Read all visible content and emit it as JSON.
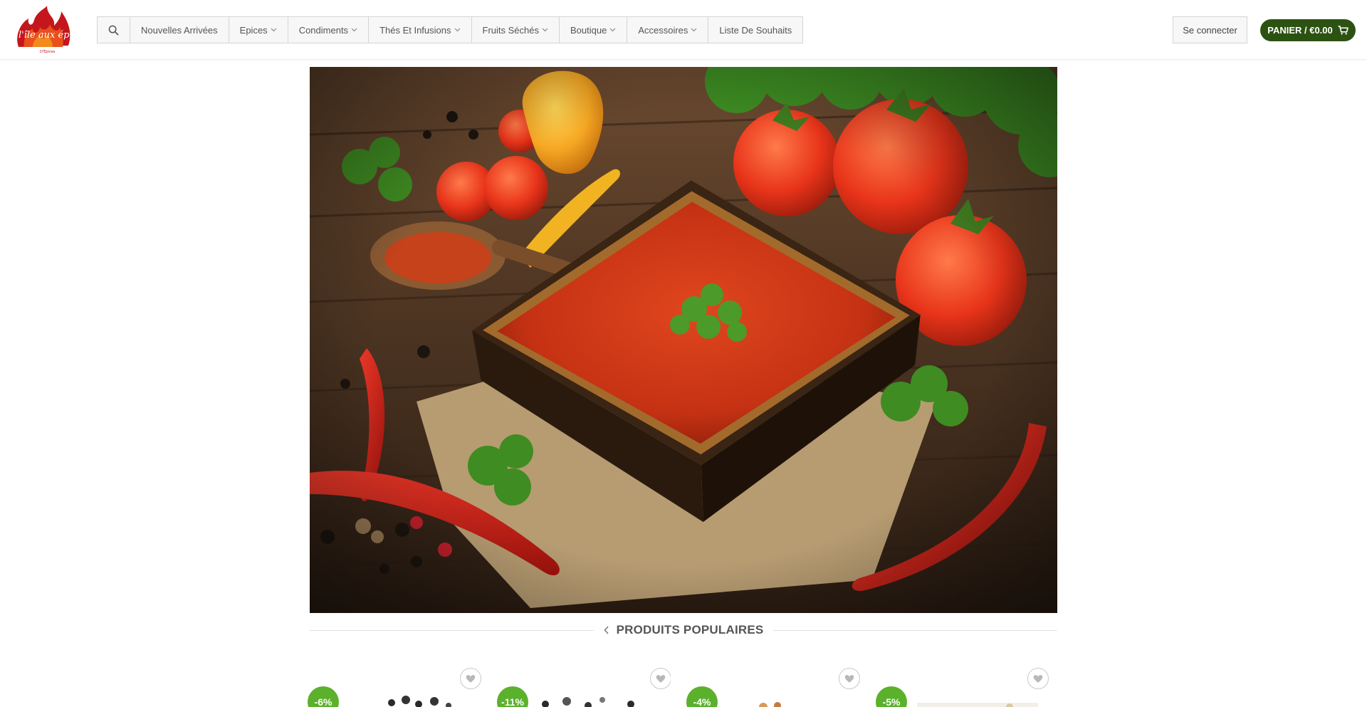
{
  "brand": {
    "logo_text": "l'île aux épices",
    "logo_subtext": "D'Épices"
  },
  "nav": {
    "search_icon": "search-icon",
    "items": [
      {
        "label": "Nouvelles Arrivées",
        "has_dropdown": false
      },
      {
        "label": "Epices",
        "has_dropdown": true
      },
      {
        "label": "Condiments",
        "has_dropdown": true
      },
      {
        "label": "Thés Et Infusions",
        "has_dropdown": true
      },
      {
        "label": "Fruits Séchés",
        "has_dropdown": true
      },
      {
        "label": "Boutique",
        "has_dropdown": true
      },
      {
        "label": "Accessoires",
        "has_dropdown": true
      },
      {
        "label": "Liste De Souhaits",
        "has_dropdown": false
      }
    ]
  },
  "account": {
    "login_label": "Se connecter",
    "cart_label": "PANIER / €0.00",
    "cart_icon": "cart-icon"
  },
  "hero": {
    "image": "tomato-sauce-with-chili-peppers-photo"
  },
  "section": {
    "title": "PRODUITS POPULAIRES"
  },
  "products": [
    {
      "discount": "-6%"
    },
    {
      "discount": "-11%"
    },
    {
      "discount": "-4%"
    },
    {
      "discount": "-5%"
    }
  ],
  "colors": {
    "cart_bg": "#2c5212",
    "badge_bg": "#5bb12c",
    "nav_bg": "#f7f7f7",
    "nav_border": "#d4d4d4"
  }
}
